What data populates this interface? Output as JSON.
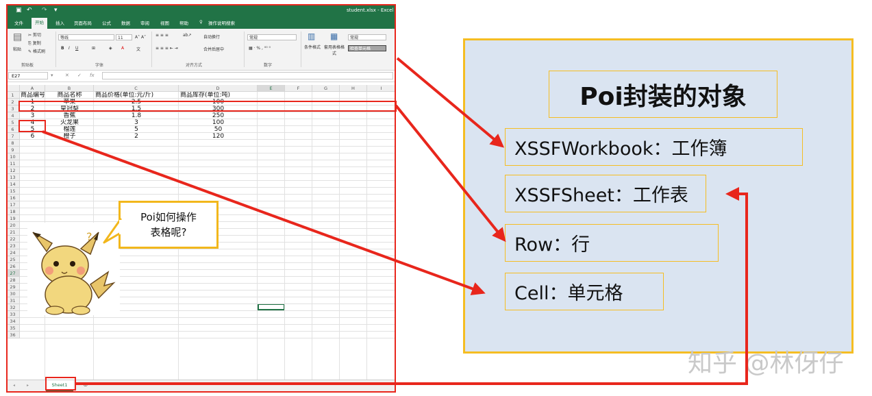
{
  "excel": {
    "filename": "student.xlsx  -  Excel",
    "tabs": [
      "文件",
      "开始",
      "插入",
      "页面布局",
      "公式",
      "数据",
      "审阅",
      "视图",
      "帮助"
    ],
    "search_hint": "操作说明搜索",
    "ribbon": {
      "paste": "粘贴",
      "cut": "剪切",
      "copy": "复制",
      "format_painter": "格式刷",
      "clipboard_group": "剪贴板",
      "font_name": "等线",
      "font_size": "11",
      "font_group": "字体",
      "wrap_text": "自动换行",
      "merge_center": "合并后居中",
      "align_group": "对齐方式",
      "number_format": "常规",
      "number_group": "数字",
      "conditional_format": "条件格式",
      "table_format": "套用表格格式",
      "style_normal": "常规",
      "style_check": "检查单元格"
    },
    "name_box": "E27",
    "columns": [
      "A",
      "B",
      "C",
      "D",
      "E",
      "F",
      "G",
      "H",
      "I"
    ],
    "headers": [
      "商品编号",
      "商品名称",
      "商品价格(单位:元/斤)",
      "商品库存(单位:吨)"
    ],
    "rows": [
      [
        "1",
        "苹果",
        "2.5",
        "100"
      ],
      [
        "2",
        "皇冠梨",
        "1.5",
        "300"
      ],
      [
        "3",
        "香蕉",
        "1.8",
        "250"
      ],
      [
        "4",
        "火龙果",
        "3",
        "100"
      ],
      [
        "5",
        "榴莲",
        "5",
        "50"
      ],
      [
        "6",
        "橙子",
        "2",
        "120"
      ]
    ],
    "row_count": 36,
    "sheet_tab": "Sheet1"
  },
  "bubble": {
    "line1": "Poi如何操作",
    "line2": "表格呢?"
  },
  "diagram": {
    "title": "Poi封装的对象",
    "items": [
      {
        "label": "XSSFWorkbook：工作簿"
      },
      {
        "label": "XSSFSheet：工作表"
      },
      {
        "label": "Row：行"
      },
      {
        "label": "Cell：单元格"
      }
    ]
  },
  "watermark": "知乎 @林伢仔",
  "colors": {
    "highlight": "#e8261c",
    "excel_green": "#217346",
    "panel_bg": "#dae4f1",
    "panel_border": "#f5bd22"
  }
}
